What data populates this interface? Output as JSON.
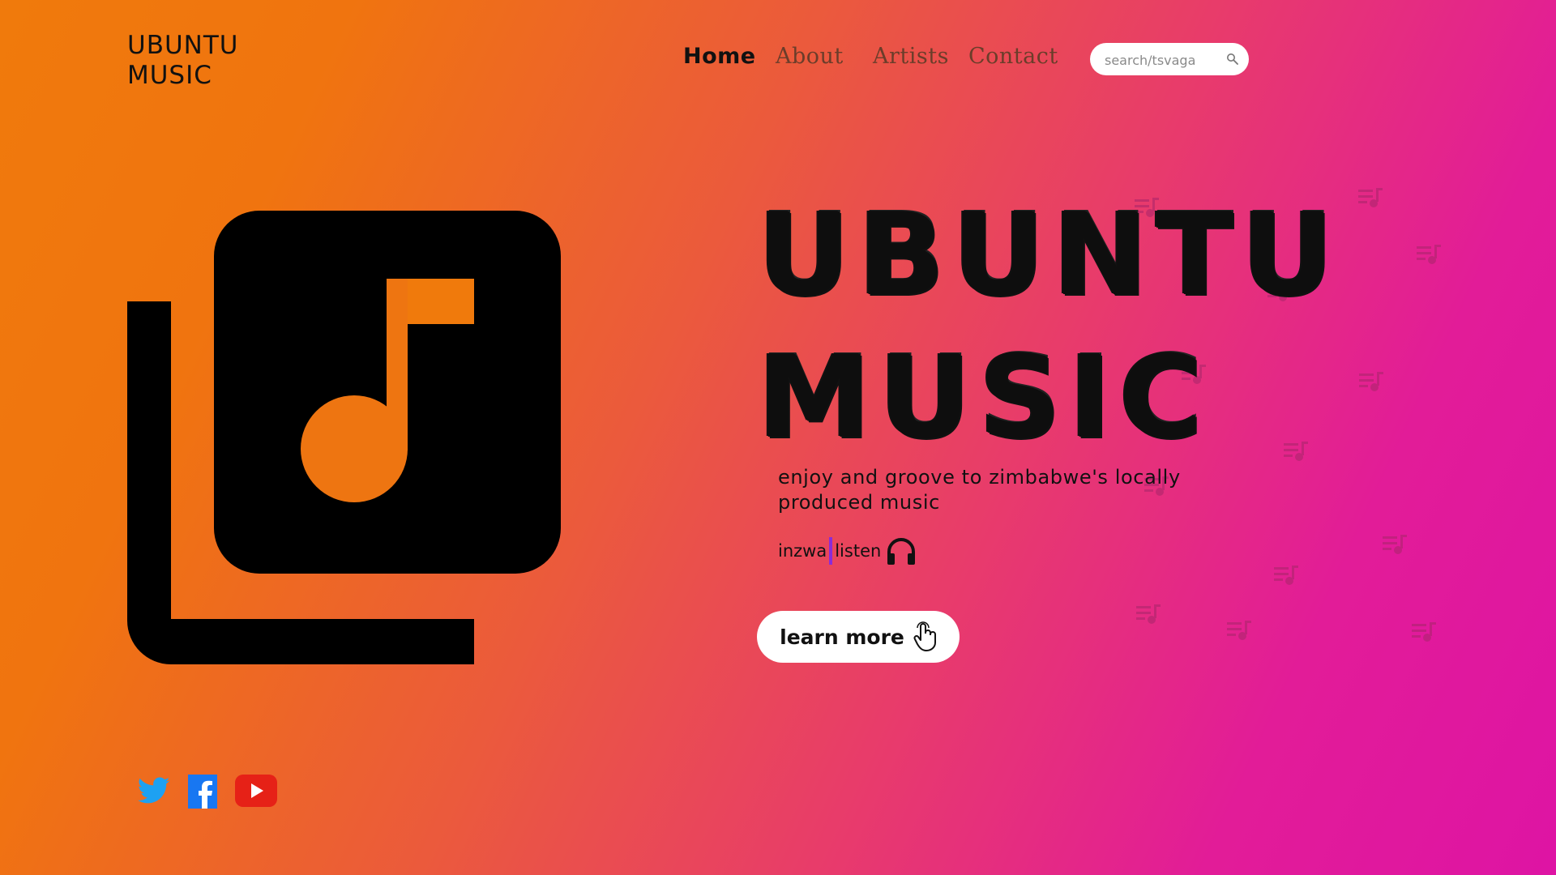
{
  "logo": {
    "line1": "UBUNTU",
    "line2": "MUSIC"
  },
  "nav": {
    "items": [
      {
        "label": "Home",
        "active": true
      },
      {
        "label": "About",
        "active": false
      },
      {
        "label": "Artists",
        "active": false
      },
      {
        "label": "Contact",
        "active": false
      }
    ]
  },
  "search": {
    "placeholder": "search/tsvaga",
    "icon": "search-icon"
  },
  "hero": {
    "title_line1": "UBUNTU",
    "title_line2": "MUSIC",
    "tagline": "enjoy and groove to zimbabwe's  locally produced music",
    "listen_word1": "inzwa",
    "listen_word2": "listen",
    "cta_label": "learn more",
    "main_icon": "music-library-icon"
  },
  "socials": [
    {
      "name": "twitter",
      "icon": "twitter-icon"
    },
    {
      "name": "facebook",
      "icon": "facebook-icon"
    },
    {
      "name": "youtube",
      "icon": "youtube-icon"
    }
  ],
  "colors": {
    "gradient_start": "#f07a0c",
    "gradient_end": "#de14a4",
    "twitter": "#1da1f2",
    "facebook": "#1877f2",
    "youtube": "#e62117",
    "cursor": "#8b2bd8"
  }
}
